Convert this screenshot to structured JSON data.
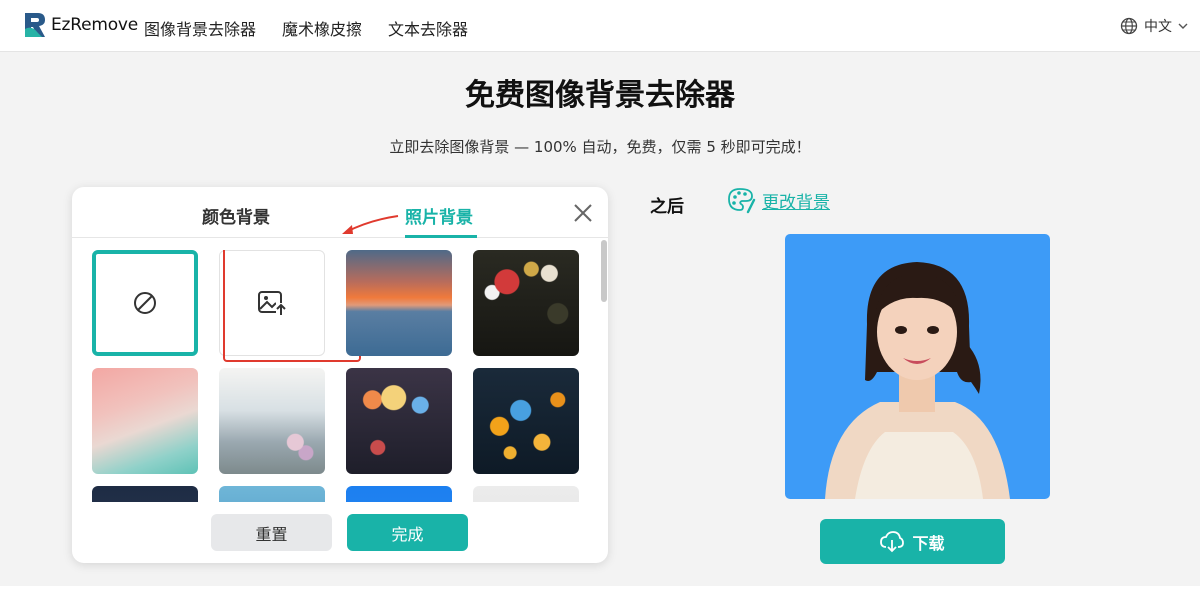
{
  "header": {
    "logo_text": "EzRemove",
    "nav": [
      "图像背景去除器",
      "魔术橡皮擦",
      "文本去除器"
    ],
    "language": "中文"
  },
  "page": {
    "title": "免费图像背景去除器",
    "subtitle": "立即去除图像背景 — 100% 自动，免费，仅需 5 秒即可完成！"
  },
  "modal": {
    "tab_color": "颜色背景",
    "tab_photo": "照片背景",
    "active_tab": "照片背景",
    "tiles": [
      {
        "name": "none-tile",
        "kind": "none"
      },
      {
        "name": "upload-tile",
        "kind": "upload"
      },
      {
        "name": "sunset-sea-tile",
        "kind": "image"
      },
      {
        "name": "rain-bokeh-tile",
        "kind": "image"
      },
      {
        "name": "pink-teal-brush-tile",
        "kind": "image"
      },
      {
        "name": "raindrops-light-tile",
        "kind": "image"
      },
      {
        "name": "city-rain-tile",
        "kind": "image"
      },
      {
        "name": "gold-bokeh-tile",
        "kind": "image"
      },
      {
        "name": "night-sky-tile",
        "kind": "image"
      },
      {
        "name": "palm-sea-tile",
        "kind": "image"
      },
      {
        "name": "blue-gradient-tile",
        "kind": "image"
      },
      {
        "name": "white-texture-tile",
        "kind": "image"
      }
    ],
    "reset_label": "重置",
    "done_label": "完成"
  },
  "result": {
    "after_label": "之后",
    "change_bg_label": "更改背景",
    "download_label": "下载",
    "background_color": "#3d9bf7"
  },
  "colors": {
    "accent": "#19b3a8",
    "highlight": "#e03a2e"
  }
}
